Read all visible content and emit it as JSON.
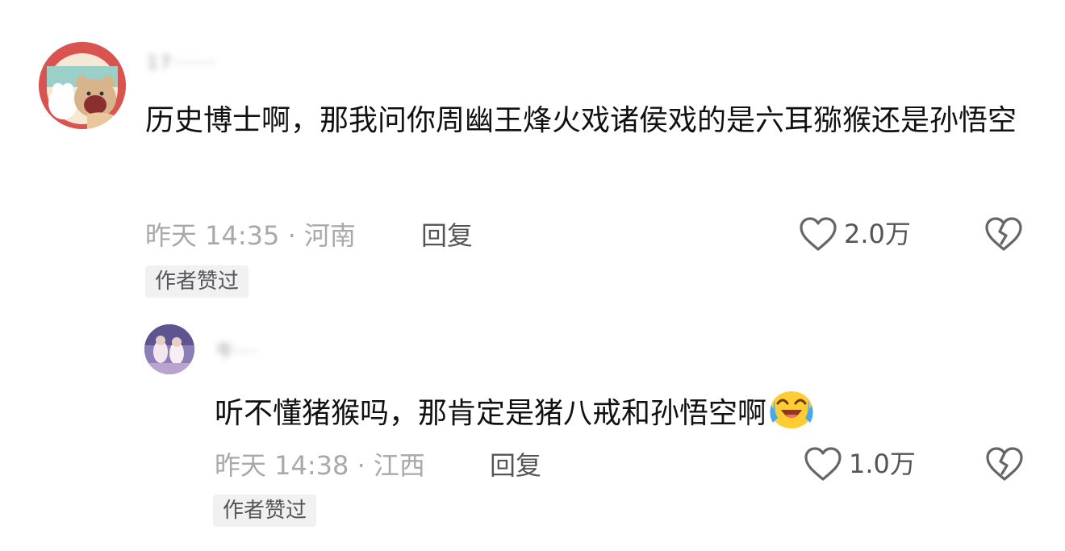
{
  "comments": [
    {
      "username": "17······",
      "avatar_icon": "cartoon-bear-avatar",
      "text": "历史博士啊，那我问你周幽王烽火戏诸侯戏的是六耳猕猴还是孙悟空",
      "meta": "昨天 14:35 · 河南",
      "reply_label": "回复",
      "likes": "2.0万",
      "badge": "作者赞过"
    },
    {
      "username": "牛···",
      "avatar_icon": "people-photo-avatar",
      "text": "听不懂猪猴吗，那肯定是猪八戒和孙悟空啊",
      "emoji": "crying-laughing-emoji",
      "meta": "昨天 14:38 · 江西",
      "reply_label": "回复",
      "likes": "1.0万",
      "badge": "作者赞过"
    }
  ],
  "colors": {
    "text_primary": "#111111",
    "text_secondary": "#a8a8ad",
    "badge_bg": "#f1f1f2",
    "icon_gray": "#666666"
  }
}
